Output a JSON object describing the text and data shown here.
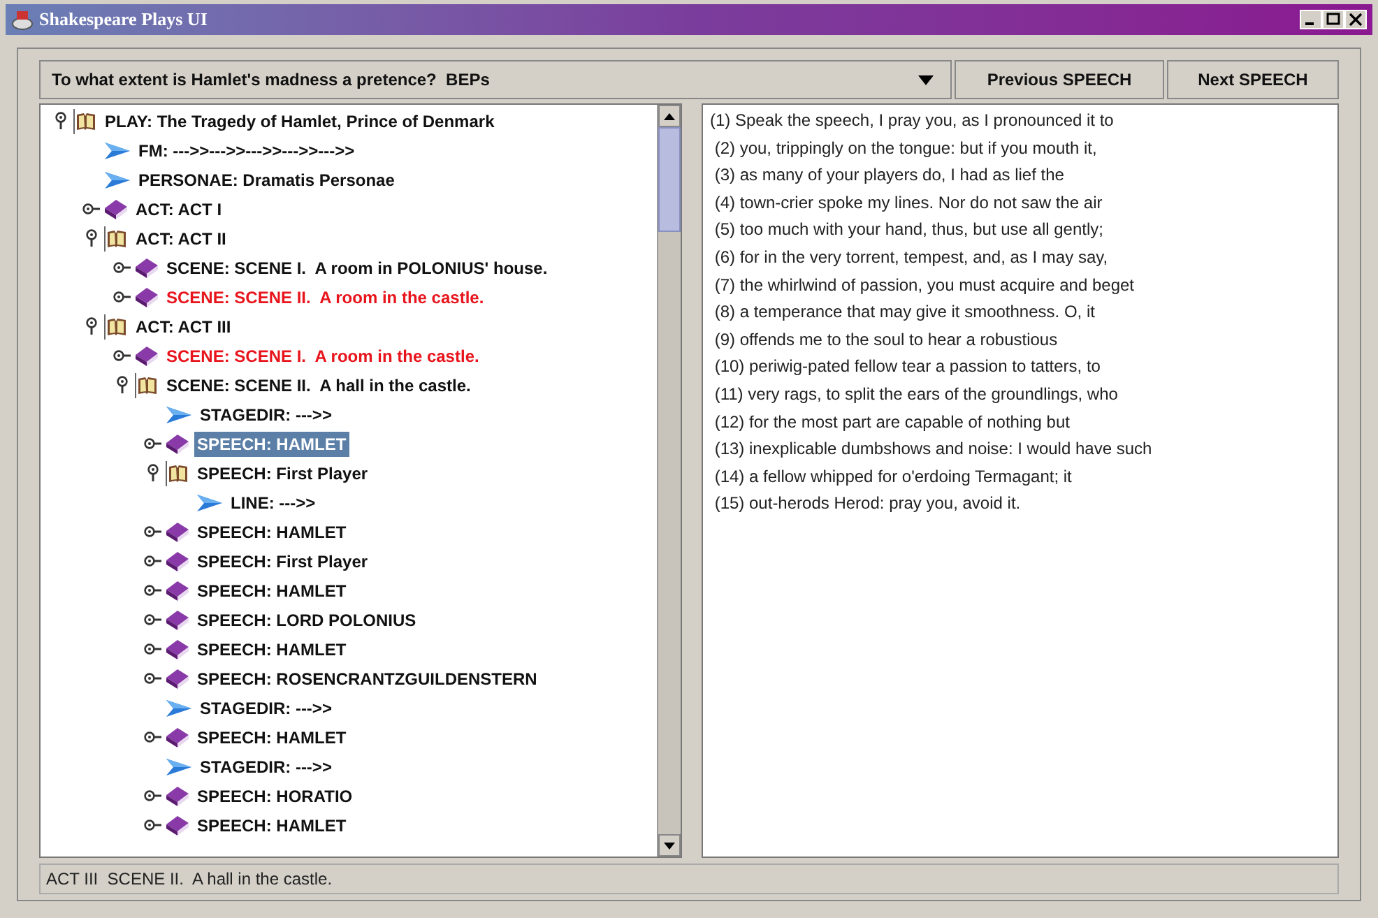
{
  "window": {
    "title": "Shakespeare Plays UI"
  },
  "question_dropdown": {
    "value": "To what extent is Hamlet's madness a pretence?  BEPs"
  },
  "buttons": [
    "Previous SPEECH",
    "Next SPEECH"
  ],
  "tree": [
    {
      "kind": "open",
      "label": "PLAY: The Tragedy of Hamlet, Prince of Denmark",
      "highlighted": false,
      "selected": false,
      "children": [
        {
          "kind": "leaf",
          "label": "FM: --->>--->>--->>--->>--->>",
          "highlighted": false,
          "selected": false
        },
        {
          "kind": "leaf",
          "label": "PERSONAE: Dramatis Personae",
          "highlighted": false,
          "selected": false
        },
        {
          "kind": "closed",
          "label": "ACT: ACT I",
          "highlighted": false,
          "selected": false
        },
        {
          "kind": "open",
          "label": "ACT: ACT II",
          "highlighted": false,
          "selected": false,
          "children": [
            {
              "kind": "closed",
              "label": "SCENE: SCENE I.  A room in POLONIUS' house.",
              "highlighted": false,
              "selected": false
            },
            {
              "kind": "closed",
              "label": "SCENE: SCENE II.  A room in the castle.",
              "highlighted": true,
              "selected": false
            }
          ]
        },
        {
          "kind": "open",
          "label": "ACT: ACT III",
          "highlighted": false,
          "selected": false,
          "children": [
            {
              "kind": "closed",
              "label": "SCENE: SCENE I.  A room in the castle.",
              "highlighted": true,
              "selected": false
            },
            {
              "kind": "open",
              "label": "SCENE: SCENE II.  A hall in the castle.",
              "highlighted": false,
              "selected": false,
              "children": [
                {
                  "kind": "leaf",
                  "label": "STAGEDIR: --->>",
                  "highlighted": false,
                  "selected": false
                },
                {
                  "kind": "closed",
                  "label": "SPEECH: HAMLET",
                  "highlighted": false,
                  "selected": true
                },
                {
                  "kind": "open",
                  "label": "SPEECH: First Player",
                  "highlighted": false,
                  "selected": false,
                  "children": [
                    {
                      "kind": "leaf",
                      "label": "LINE: --->>",
                      "highlighted": false,
                      "selected": false
                    }
                  ]
                },
                {
                  "kind": "closed",
                  "label": "SPEECH: HAMLET",
                  "highlighted": false,
                  "selected": false
                },
                {
                  "kind": "closed",
                  "label": "SPEECH: First Player",
                  "highlighted": false,
                  "selected": false
                },
                {
                  "kind": "closed",
                  "label": "SPEECH: HAMLET",
                  "highlighted": false,
                  "selected": false
                },
                {
                  "kind": "closed",
                  "label": "SPEECH: LORD POLONIUS",
                  "highlighted": false,
                  "selected": false
                },
                {
                  "kind": "closed",
                  "label": "SPEECH: HAMLET",
                  "highlighted": false,
                  "selected": false
                },
                {
                  "kind": "closed",
                  "label": "SPEECH: ROSENCRANTZGUILDENSTERN",
                  "highlighted": false,
                  "selected": false
                },
                {
                  "kind": "leaf",
                  "label": "STAGEDIR: --->>",
                  "highlighted": false,
                  "selected": false
                },
                {
                  "kind": "closed",
                  "label": "SPEECH: HAMLET",
                  "highlighted": false,
                  "selected": false
                },
                {
                  "kind": "leaf",
                  "label": "STAGEDIR: --->>",
                  "highlighted": false,
                  "selected": false
                },
                {
                  "kind": "closed",
                  "label": "SPEECH: HORATIO",
                  "highlighted": false,
                  "selected": false
                },
                {
                  "kind": "closed",
                  "label": "SPEECH: HAMLET",
                  "highlighted": false,
                  "selected": false
                }
              ]
            }
          ]
        }
      ]
    }
  ],
  "speech_lines": [
    "(1) Speak the speech, I pray you, as I pronounced it to",
    " (2) you, trippingly on the tongue: but if you mouth it,",
    " (3) as many of your players do, I had as lief the",
    " (4) town-crier spoke my lines. Nor do not saw the air",
    " (5) too much with your hand, thus, but use all gently;",
    " (6) for in the very torrent, tempest, and, as I may say,",
    " (7) the whirlwind of passion, you must acquire and beget",
    " (8) a temperance that may give it smoothness. O, it",
    " (9) offends me to the soul to hear a robustious",
    " (10) periwig-pated fellow tear a passion to tatters, to",
    " (11) very rags, to split the ears of the groundlings, who",
    " (12) for the most part are capable of nothing but",
    " (13) inexplicable dumbshows and noise: I would have such",
    " (14) a fellow whipped for o'erdoing Termagant; it",
    " (15) out-herods Herod: pray you, avoid it."
  ],
  "status_bar": "ACT III  SCENE II.  A hall in the castle."
}
